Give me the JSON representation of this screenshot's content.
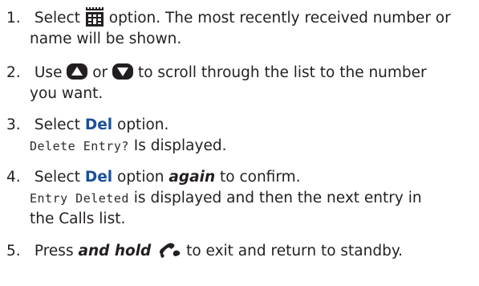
{
  "icons": {
    "calls_list": "calls-list-icon",
    "up": "up-arrow-icon",
    "down": "down-arrow-icon",
    "end_call": "end-call-icon"
  },
  "colors": {
    "highlight": "#1a4f9c",
    "text": "#231f20"
  },
  "steps": [
    {
      "number": "1.",
      "before_icon": "Select",
      "after_icon": "option. The most recently received number or",
      "line2": "name will be shown."
    },
    {
      "number": "2.",
      "before_icon": "Use",
      "between_icons": "or",
      "after_icon": "to scroll through the list to the number",
      "line2": "you want."
    },
    {
      "number": "3.",
      "before_option": "Select",
      "option": "Del",
      "after_option": "option.",
      "display_text": "Delete Entry?",
      "after_display": "Is displayed."
    },
    {
      "number": "4.",
      "before_option": "Select",
      "option": "Del",
      "after_option": "option",
      "emphasis": "again",
      "after_emphasis": "to confirm.",
      "display_text": "Entry Deleted",
      "after_display": "is displayed and then the next entry in",
      "line3": "the Calls list."
    },
    {
      "number": "5.",
      "before_emphasis": "Press",
      "emphasis": "and hold",
      "after_icon": "to exit and return to standby."
    }
  ]
}
